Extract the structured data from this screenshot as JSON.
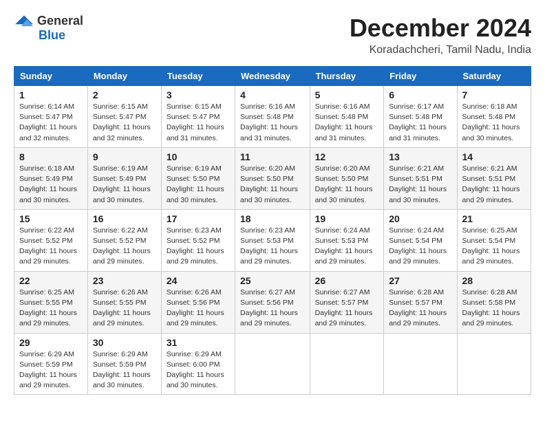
{
  "logo": {
    "general": "General",
    "blue": "Blue"
  },
  "title": "December 2024",
  "subtitle": "Koradachcheri, Tamil Nadu, India",
  "days_of_week": [
    "Sunday",
    "Monday",
    "Tuesday",
    "Wednesday",
    "Thursday",
    "Friday",
    "Saturday"
  ],
  "weeks": [
    [
      {
        "day": "1",
        "info": "Sunrise: 6:14 AM\nSunset: 5:47 PM\nDaylight: 11 hours\nand 32 minutes."
      },
      {
        "day": "2",
        "info": "Sunrise: 6:15 AM\nSunset: 5:47 PM\nDaylight: 11 hours\nand 32 minutes."
      },
      {
        "day": "3",
        "info": "Sunrise: 6:15 AM\nSunset: 5:47 PM\nDaylight: 11 hours\nand 31 minutes."
      },
      {
        "day": "4",
        "info": "Sunrise: 6:16 AM\nSunset: 5:48 PM\nDaylight: 11 hours\nand 31 minutes."
      },
      {
        "day": "5",
        "info": "Sunrise: 6:16 AM\nSunset: 5:48 PM\nDaylight: 11 hours\nand 31 minutes."
      },
      {
        "day": "6",
        "info": "Sunrise: 6:17 AM\nSunset: 5:48 PM\nDaylight: 11 hours\nand 31 minutes."
      },
      {
        "day": "7",
        "info": "Sunrise: 6:18 AM\nSunset: 5:48 PM\nDaylight: 11 hours\nand 30 minutes."
      }
    ],
    [
      {
        "day": "8",
        "info": "Sunrise: 6:18 AM\nSunset: 5:49 PM\nDaylight: 11 hours\nand 30 minutes."
      },
      {
        "day": "9",
        "info": "Sunrise: 6:19 AM\nSunset: 5:49 PM\nDaylight: 11 hours\nand 30 minutes."
      },
      {
        "day": "10",
        "info": "Sunrise: 6:19 AM\nSunset: 5:50 PM\nDaylight: 11 hours\nand 30 minutes."
      },
      {
        "day": "11",
        "info": "Sunrise: 6:20 AM\nSunset: 5:50 PM\nDaylight: 11 hours\nand 30 minutes."
      },
      {
        "day": "12",
        "info": "Sunrise: 6:20 AM\nSunset: 5:50 PM\nDaylight: 11 hours\nand 30 minutes."
      },
      {
        "day": "13",
        "info": "Sunrise: 6:21 AM\nSunset: 5:51 PM\nDaylight: 11 hours\nand 30 minutes."
      },
      {
        "day": "14",
        "info": "Sunrise: 6:21 AM\nSunset: 5:51 PM\nDaylight: 11 hours\nand 29 minutes."
      }
    ],
    [
      {
        "day": "15",
        "info": "Sunrise: 6:22 AM\nSunset: 5:52 PM\nDaylight: 11 hours\nand 29 minutes."
      },
      {
        "day": "16",
        "info": "Sunrise: 6:22 AM\nSunset: 5:52 PM\nDaylight: 11 hours\nand 29 minutes."
      },
      {
        "day": "17",
        "info": "Sunrise: 6:23 AM\nSunset: 5:52 PM\nDaylight: 11 hours\nand 29 minutes."
      },
      {
        "day": "18",
        "info": "Sunrise: 6:23 AM\nSunset: 5:53 PM\nDaylight: 11 hours\nand 29 minutes."
      },
      {
        "day": "19",
        "info": "Sunrise: 6:24 AM\nSunset: 5:53 PM\nDaylight: 11 hours\nand 29 minutes."
      },
      {
        "day": "20",
        "info": "Sunrise: 6:24 AM\nSunset: 5:54 PM\nDaylight: 11 hours\nand 29 minutes."
      },
      {
        "day": "21",
        "info": "Sunrise: 6:25 AM\nSunset: 5:54 PM\nDaylight: 11 hours\nand 29 minutes."
      }
    ],
    [
      {
        "day": "22",
        "info": "Sunrise: 6:25 AM\nSunset: 5:55 PM\nDaylight: 11 hours\nand 29 minutes."
      },
      {
        "day": "23",
        "info": "Sunrise: 6:26 AM\nSunset: 5:55 PM\nDaylight: 11 hours\nand 29 minutes."
      },
      {
        "day": "24",
        "info": "Sunrise: 6:26 AM\nSunset: 5:56 PM\nDaylight: 11 hours\nand 29 minutes."
      },
      {
        "day": "25",
        "info": "Sunrise: 6:27 AM\nSunset: 5:56 PM\nDaylight: 11 hours\nand 29 minutes."
      },
      {
        "day": "26",
        "info": "Sunrise: 6:27 AM\nSunset: 5:57 PM\nDaylight: 11 hours\nand 29 minutes."
      },
      {
        "day": "27",
        "info": "Sunrise: 6:28 AM\nSunset: 5:57 PM\nDaylight: 11 hours\nand 29 minutes."
      },
      {
        "day": "28",
        "info": "Sunrise: 6:28 AM\nSunset: 5:58 PM\nDaylight: 11 hours\nand 29 minutes."
      }
    ],
    [
      {
        "day": "29",
        "info": "Sunrise: 6:29 AM\nSunset: 5:59 PM\nDaylight: 11 hours\nand 29 minutes."
      },
      {
        "day": "30",
        "info": "Sunrise: 6:29 AM\nSunset: 5:59 PM\nDaylight: 11 hours\nand 30 minutes."
      },
      {
        "day": "31",
        "info": "Sunrise: 6:29 AM\nSunset: 6:00 PM\nDaylight: 11 hours\nand 30 minutes."
      },
      {
        "day": "",
        "info": ""
      },
      {
        "day": "",
        "info": ""
      },
      {
        "day": "",
        "info": ""
      },
      {
        "day": "",
        "info": ""
      }
    ]
  ]
}
